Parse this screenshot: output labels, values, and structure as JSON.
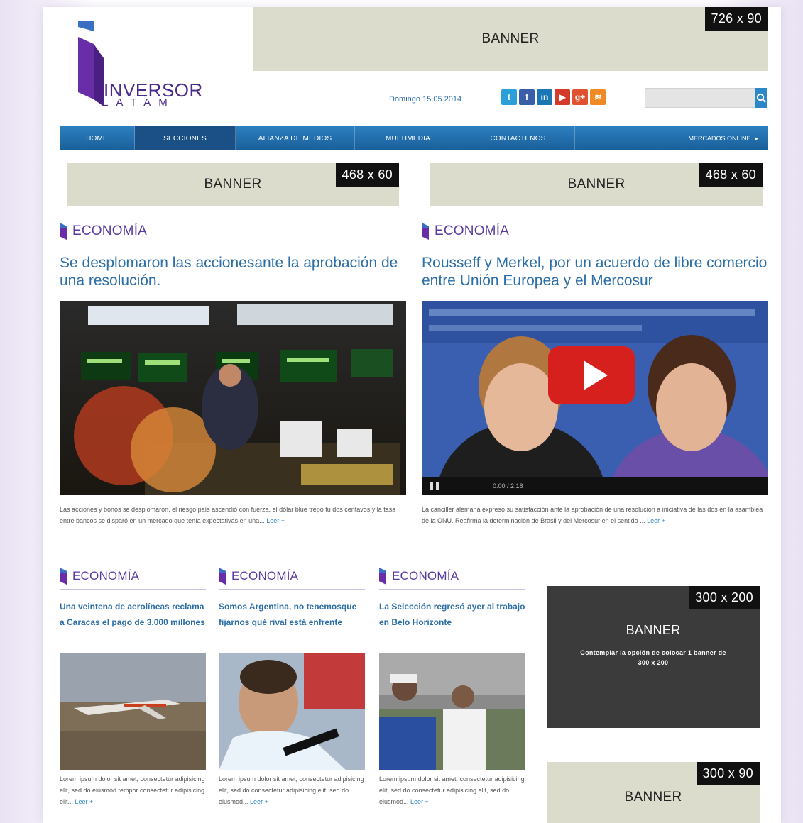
{
  "header": {
    "logo_name": "INVERSOR",
    "logo_sub": "LATAM",
    "top_banner": {
      "label": "BANNER",
      "size": "726 x 90"
    },
    "date": "Domingo 15.05.2014",
    "social": [
      "twitter-icon",
      "facebook-icon",
      "linkedin-icon",
      "youtube-icon",
      "googleplus-icon",
      "rss-icon"
    ],
    "search": {
      "placeholder": ""
    }
  },
  "nav": {
    "items": [
      "HOME",
      "SECCIONES",
      "ALIANZA DE MEDIOS",
      "MULTIMEDIA",
      "CONTACTENOS"
    ],
    "extra": "MERCADOS ONLINE"
  },
  "ad_row": [
    {
      "label": "BANNER",
      "size": "468 x 60"
    },
    {
      "label": "BANNER",
      "size": "468 x 60"
    }
  ],
  "top_stories": [
    {
      "section": "ECONOMÍA",
      "title": "Se desplomaron las accionesante la aprobación de una resolución.",
      "excerpt": "Las acciones y bonos se desplomaron, el riesgo país ascendió con fuerza, el dólar blue trepó tu dos centavos y la tasa entre bancos se disparó en un mercado que tenía expectativas en una...",
      "more": "Leer +"
    },
    {
      "section": "ECONOMÍA",
      "title": "Rousseff y Merkel, por un acuerdo de libre comercio entre Unión Europea y el Mercosur",
      "excerpt": "La canciller alemana expresó su satisfacción ante la aprobación de una resolución a iniciativa de las dos en la asamblea de la ONU. Reafirma la determinación de Brasil y del Mercosur en el sentido ...",
      "more": "Leer +",
      "video": {
        "time": "0:00 / 2:18"
      }
    }
  ],
  "small_stories": [
    {
      "section": "ECONOMÍA",
      "title": "Una veintena de aerolíneas reclama a Caracas el pago de 3.000 millones",
      "excerpt": "Lorem ipsum dolor sit amet, consectetur adipisicing elit, sed do eiusmod tempor consectetur adipisicing elit...",
      "more": "Leer +"
    },
    {
      "section": "ECONOMÍA",
      "title": "Somos Argentina, no tenemosque fijarnos qué rival está enfrente",
      "excerpt": "Lorem ipsum dolor sit amet, consectetur adipisicing elit, sed do consectetur adipisicing elit, sed do eiusmod...",
      "more": "Leer +"
    },
    {
      "section": "ECONOMÍA",
      "title": "La Selección regresó ayer al trabajo en Belo Horizonte",
      "excerpt": "Lorem ipsum dolor sit amet, consectetur adipisicing elit, sed do consectetur adipisicing elit, sed do eiusmod...",
      "more": "Leer +"
    }
  ],
  "side_banners": [
    {
      "label": "BANNER",
      "size": "300 x 200",
      "note": "Contemplar la opción de colocar 1 banner de 300 x 200"
    },
    {
      "label": "BANNER",
      "size": "300 x 90"
    }
  ],
  "colors": {
    "accent": "#2c6fa8",
    "brand": "#5a3aa0",
    "nav": "#1f6bab",
    "banner": "#dcdccd"
  }
}
